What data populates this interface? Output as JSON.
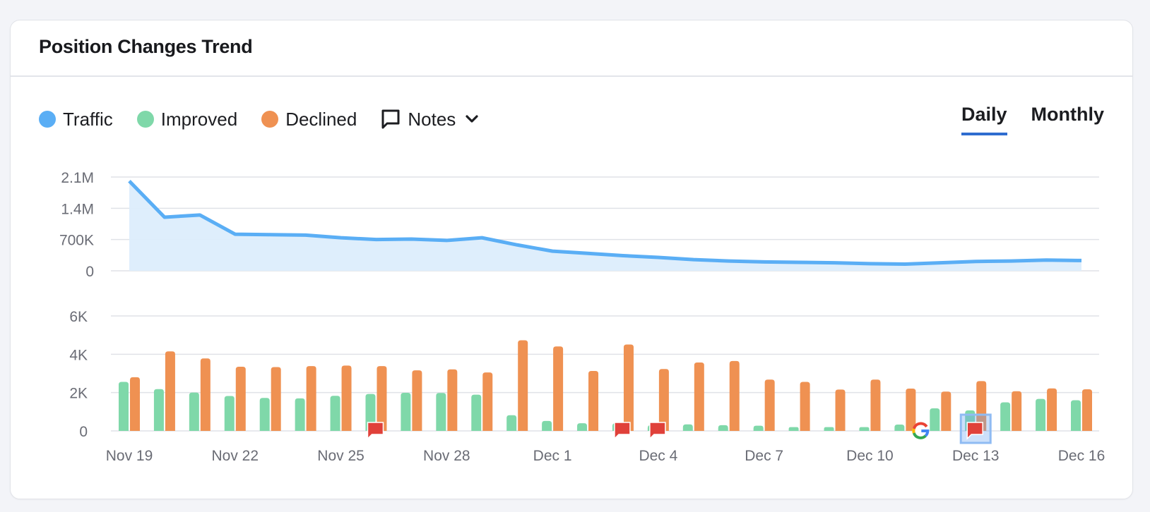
{
  "card": {
    "title": "Position Changes Trend"
  },
  "legend": {
    "items": [
      {
        "label": "Traffic",
        "color": "#5aaef5",
        "icon": "circle-dot"
      },
      {
        "label": "Improved",
        "color": "#7fd8a9",
        "icon": "circle-dot"
      },
      {
        "label": "Declined",
        "color": "#ef9152",
        "icon": "circle-dot"
      }
    ],
    "notes_label": "Notes",
    "notes_icon": "speech-bubble-icon",
    "notes_dropdown_icon": "chevron-down-icon"
  },
  "tabs": [
    {
      "label": "Daily",
      "active": true
    },
    {
      "label": "Monthly",
      "active": false
    }
  ],
  "colors": {
    "traffic_line": "#5aaef5",
    "traffic_fill": "#dcedfc",
    "improved": "#7fd8a9",
    "declined": "#ef9152",
    "note_flag": "#e0413a",
    "tab_underline": "#2f6ccf",
    "grid": "#e0e2e7"
  },
  "chart_data": [
    {
      "type": "area",
      "title": "Traffic",
      "x": [
        "Nov 19",
        "Nov 20",
        "Nov 21",
        "Nov 22",
        "Nov 23",
        "Nov 24",
        "Nov 25",
        "Nov 26",
        "Nov 27",
        "Nov 28",
        "Nov 29",
        "Nov 30",
        "Dec 1",
        "Dec 2",
        "Dec 3",
        "Dec 4",
        "Dec 5",
        "Dec 6",
        "Dec 7",
        "Dec 8",
        "Dec 9",
        "Dec 10",
        "Dec 11",
        "Dec 12",
        "Dec 13",
        "Dec 14",
        "Dec 15",
        "Dec 16"
      ],
      "series": [
        {
          "name": "Traffic",
          "values": [
            2010000,
            1200000,
            1250000,
            820000,
            810000,
            800000,
            740000,
            700000,
            710000,
            680000,
            740000,
            580000,
            440000,
            390000,
            340000,
            300000,
            250000,
            220000,
            200000,
            190000,
            180000,
            160000,
            150000,
            180000,
            210000,
            220000,
            240000,
            230000
          ]
        }
      ],
      "yticks": [
        0,
        700000,
        1400000,
        2100000
      ],
      "ytick_labels": [
        "0",
        "700K",
        "1.4M",
        "2.1M"
      ],
      "ylim": [
        0,
        2100000
      ],
      "grid": true
    },
    {
      "type": "bar",
      "title": "Position changes",
      "categories": [
        "Nov 19",
        "Nov 20",
        "Nov 21",
        "Nov 22",
        "Nov 23",
        "Nov 24",
        "Nov 25",
        "Nov 26",
        "Nov 27",
        "Nov 28",
        "Nov 29",
        "Nov 30",
        "Dec 1",
        "Dec 2",
        "Dec 3",
        "Dec 4",
        "Dec 5",
        "Dec 6",
        "Dec 7",
        "Dec 8",
        "Dec 9",
        "Dec 10",
        "Dec 11",
        "Dec 12",
        "Dec 13",
        "Dec 14",
        "Dec 15",
        "Dec 16"
      ],
      "series": [
        {
          "name": "Improved",
          "values": [
            2560,
            2180,
            2000,
            1820,
            1720,
            1700,
            1830,
            1930,
            1990,
            1980,
            1890,
            820,
            520,
            400,
            400,
            300,
            340,
            300,
            270,
            200,
            200,
            200,
            330,
            1180,
            1070,
            1490,
            1670,
            1600
          ]
        },
        {
          "name": "Declined",
          "values": [
            2800,
            4150,
            3780,
            3350,
            3330,
            3380,
            3410,
            3380,
            3160,
            3210,
            3050,
            4730,
            4410,
            3130,
            4510,
            3230,
            3570,
            3650,
            2680,
            2560,
            2160,
            2680,
            2210,
            2050,
            2600,
            2070,
            2220,
            2170
          ]
        }
      ],
      "yticks": [
        0,
        2000,
        4000,
        6000
      ],
      "ytick_labels": [
        "0",
        "2K",
        "4K",
        "6K"
      ],
      "ylim": [
        0,
        6000
      ],
      "xtick_labels": [
        "Nov 19",
        "Nov 22",
        "Nov 25",
        "Nov 28",
        "Dec 1",
        "Dec 4",
        "Dec 7",
        "Dec 10",
        "Dec 13",
        "Dec 16"
      ],
      "grid": true,
      "annotations": [
        {
          "type": "note",
          "date": "Nov 26",
          "icon": "note-flag-icon"
        },
        {
          "type": "note",
          "date": "Dec 3",
          "icon": "note-flag-icon"
        },
        {
          "type": "note",
          "date": "Dec 4",
          "icon": "note-flag-icon"
        },
        {
          "type": "google-update",
          "date": "Dec 12",
          "icon": "google-icon"
        },
        {
          "type": "note",
          "date": "Dec 13",
          "icon": "note-flag-icon",
          "highlighted": true
        }
      ]
    }
  ]
}
